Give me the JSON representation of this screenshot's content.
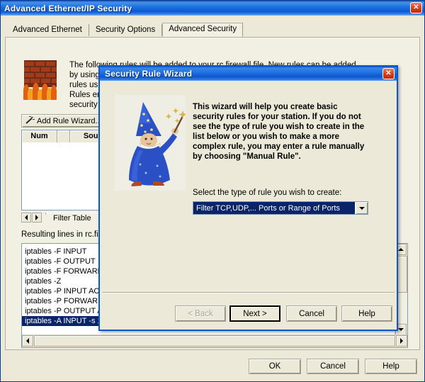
{
  "main_window": {
    "title": "Advanced Ethernet/IP Security",
    "close_icon": "close-icon",
    "tabs": [
      {
        "label": "Advanced Ethernet",
        "active": false
      },
      {
        "label": "Security Options",
        "active": false
      },
      {
        "label": "Advanced Security",
        "active": true
      }
    ],
    "firewall_icon": "firewall-brickwall-flames-icon",
    "description_lines": [
      "The following rules will be added to your rc.firewall file. New rules can be added",
      "by using the Add Rule Wizard, or more advanced users may manually enter",
      "rules using the Manual Rule entry.",
      "Rules entered here are appended to the",
      "security rules already in place."
    ],
    "add_rule_button": {
      "label": "Add Rule Wizard...",
      "icon": "magic-wand-icon"
    },
    "rules_table": {
      "headers": [
        "Num",
        "",
        "Source"
      ],
      "rows": []
    },
    "sheet_tabs": {
      "prev_icon": "caret-left-icon",
      "next_icon": "caret-right-icon",
      "active_tab": "Filter Table"
    },
    "resulting_label": "Resulting lines in rc.firewall:",
    "iptables_lines": [
      "iptables -F INPUT",
      "iptables -F OUTPUT",
      "iptables -F FORWARD",
      "iptables -Z",
      "iptables -P INPUT ACCEPT",
      "iptables -P FORWARD ACCEPT",
      "iptables -P OUTPUT ACCEPT",
      "iptables -A INPUT -s 127.0.0.1 -j ACCEPT"
    ],
    "selected_iptables_index": 7,
    "buttons": {
      "ok": "OK",
      "cancel": "Cancel",
      "help": "Help"
    }
  },
  "wizard": {
    "title": "Security Rule Wizard",
    "close_icon": "close-icon",
    "art_icon": "wizard-character-icon",
    "body_lines": [
      "This wizard will help you create basic",
      "security rules for your station. If you do not",
      "see the type of rule you wish to create in the",
      "list below or you wish to make a more",
      "complex rule, you may enter a rule manually",
      "by choosing \"Manual Rule\"."
    ],
    "select_label": "Select the type of rule you wish to create:",
    "rule_combo": {
      "value": "Filter TCP,UDP,... Ports or Range of Ports",
      "arrow_icon": "chevron-down-icon"
    },
    "buttons": {
      "back": "< Back",
      "next": "Next >",
      "cancel": "Cancel",
      "help": "Help"
    }
  },
  "colors": {
    "titlebar_blue": "#1d6fe0",
    "selection_blue": "#0a246a",
    "dialog_face": "#ece9d8",
    "panel_face": "#f2efe3",
    "close_red": "#d63b18"
  }
}
